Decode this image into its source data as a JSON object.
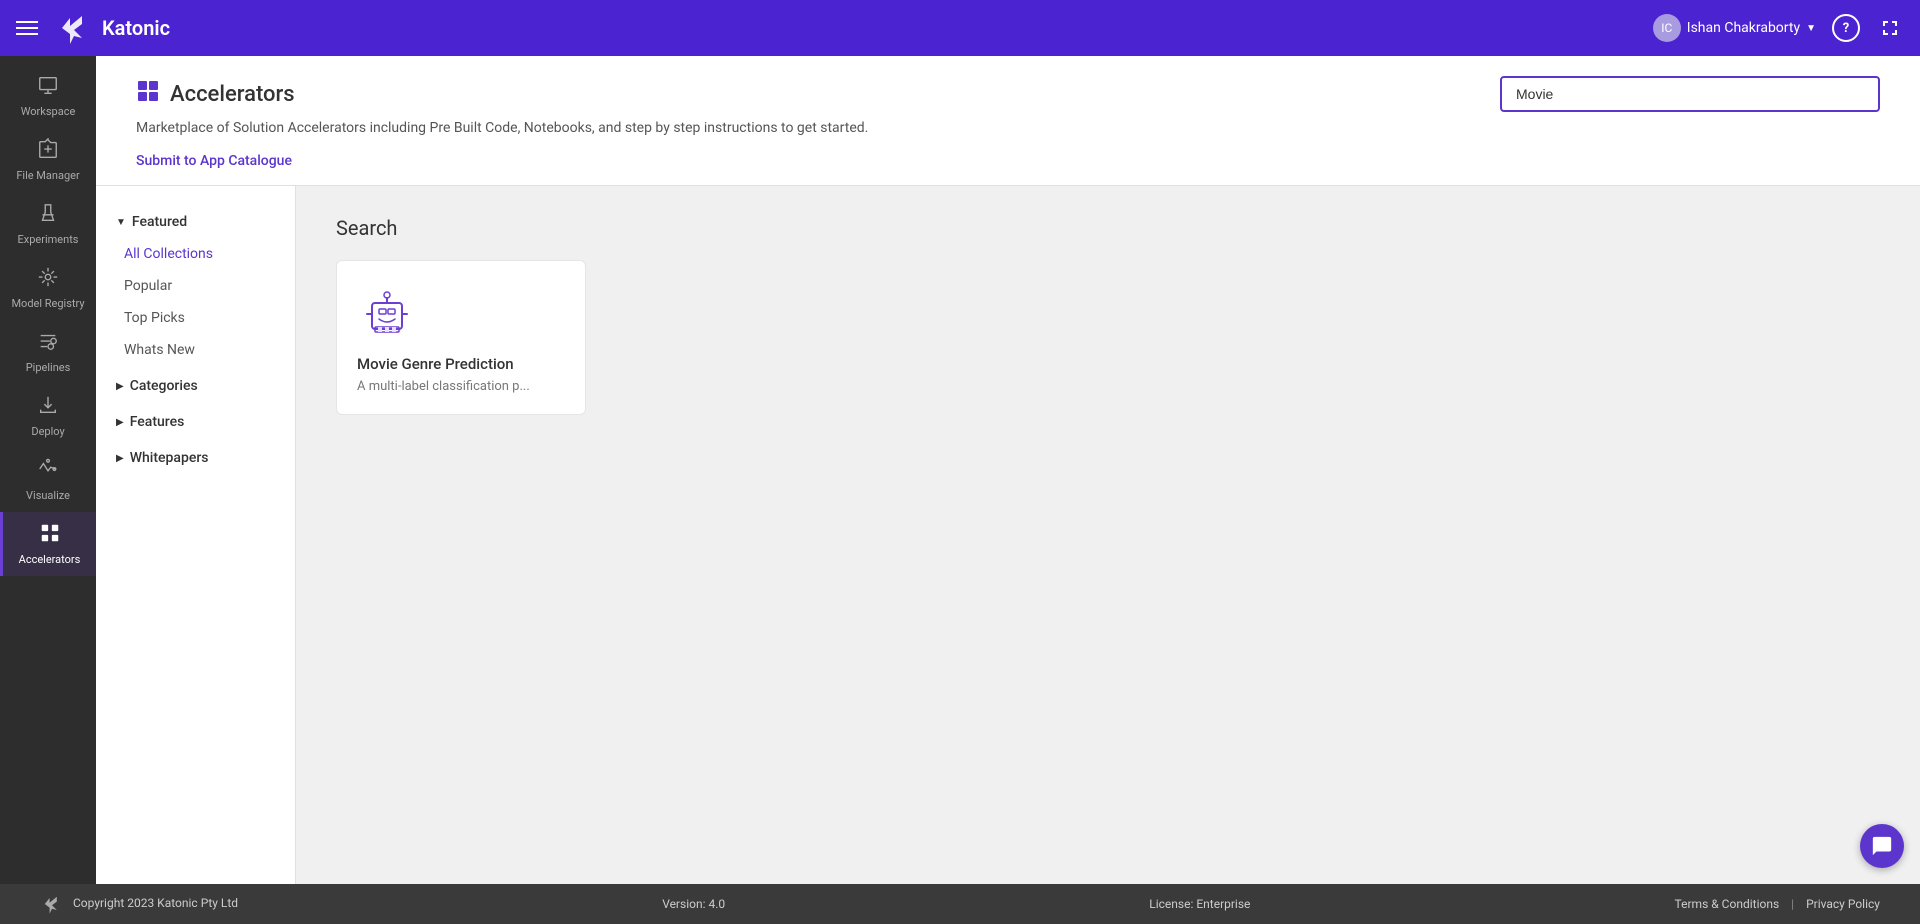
{
  "header": {
    "menu_icon": "☰",
    "logo_text": "Katonic",
    "user_name": "Ishan Chakraborty",
    "help_icon": "?",
    "expand_icon": "⤢"
  },
  "sidebar": {
    "items": [
      {
        "id": "workspace",
        "label": "Workspace",
        "icon": "🖥"
      },
      {
        "id": "file-manager",
        "label": "File Manager",
        "icon": "⭐"
      },
      {
        "id": "experiments",
        "label": "Experiments",
        "icon": "🧪"
      },
      {
        "id": "model-registry",
        "label": "Model Registry",
        "icon": "🎯"
      },
      {
        "id": "pipelines",
        "label": "Pipelines",
        "icon": "⛓"
      },
      {
        "id": "deploy",
        "label": "Deploy",
        "icon": "📥"
      },
      {
        "id": "visualize",
        "label": "Visualize",
        "icon": "✦"
      },
      {
        "id": "accelerators",
        "label": "Accelerators",
        "icon": "⊞",
        "active": true
      }
    ]
  },
  "page": {
    "title": "Accelerators",
    "description": "Marketplace of Solution Accelerators including Pre Built Code, Notebooks, and step by step instructions to get started.",
    "submit_link": "Submit to App Catalogue",
    "search_placeholder": "Movie",
    "search_value": "Movie"
  },
  "left_nav": {
    "sections": [
      {
        "id": "featured",
        "label": "Featured",
        "expanded": true,
        "items": [
          {
            "id": "all-collections",
            "label": "All Collections",
            "active": true
          },
          {
            "id": "popular",
            "label": "Popular"
          },
          {
            "id": "top-picks",
            "label": "Top Picks"
          },
          {
            "id": "whats-new",
            "label": "Whats New"
          }
        ]
      },
      {
        "id": "categories",
        "label": "Categories",
        "expanded": false,
        "items": []
      },
      {
        "id": "features",
        "label": "Features",
        "expanded": false,
        "items": []
      },
      {
        "id": "whitepapers",
        "label": "Whitepapers",
        "expanded": false,
        "items": []
      }
    ]
  },
  "main_panel": {
    "section_title": "Search",
    "cards": [
      {
        "id": "movie-genre-prediction",
        "title": "Movie Genre Prediction",
        "description": "A multi-label classification p..."
      }
    ]
  },
  "footer": {
    "copyright": "Copyright 2023 Katonic Pty Ltd",
    "version": "Version: 4.0",
    "license": "License: Enterprise",
    "links": [
      {
        "id": "terms",
        "label": "Terms & Conditions"
      },
      {
        "id": "privacy",
        "label": "Privacy Policy"
      }
    ]
  }
}
